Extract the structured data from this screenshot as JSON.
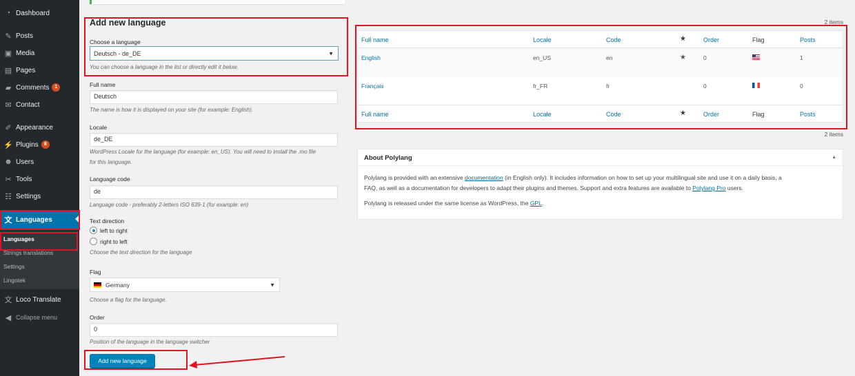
{
  "sidebar": {
    "items": [
      {
        "label": "Dashboard",
        "icon": "dashboard-icon"
      },
      {
        "label": "Posts",
        "icon": "pin-icon"
      },
      {
        "label": "Media",
        "icon": "media-icon"
      },
      {
        "label": "Pages",
        "icon": "pages-icon"
      },
      {
        "label": "Comments",
        "icon": "comments-icon",
        "badge": "1"
      },
      {
        "label": "Contact",
        "icon": "mail-icon"
      },
      {
        "label": "Appearance",
        "icon": "brush-icon"
      },
      {
        "label": "Plugins",
        "icon": "plug-icon",
        "badge": "8"
      },
      {
        "label": "Users",
        "icon": "user-icon"
      },
      {
        "label": "Tools",
        "icon": "wrench-icon"
      },
      {
        "label": "Settings",
        "icon": "sliders-icon"
      },
      {
        "label": "Languages",
        "icon": "translate-icon"
      },
      {
        "label": "Loco Translate",
        "icon": "translate-icon"
      },
      {
        "label": "Collapse menu",
        "icon": "collapse-icon"
      }
    ],
    "submenu": [
      "Languages",
      "Strings translations",
      "Settings",
      "Lingotek"
    ]
  },
  "form": {
    "title": "Add new language",
    "choose_label": "Choose a language",
    "choose_value": "Deutsch - de_DE",
    "choose_desc": "You can choose a language in the list or directly edit it below.",
    "fullname_label": "Full name",
    "fullname_value": "Deutsch",
    "fullname_desc": "The name is how it is displayed on your site (for example: English).",
    "locale_label": "Locale",
    "locale_value": "de_DE",
    "locale_desc_1": "WordPress Locale for the language (for example: en_US). You will need to install the .mo file",
    "locale_desc_2": "for this language.",
    "code_label": "Language code",
    "code_value": "de",
    "code_desc": "Language code - preferably 2-letters ISO 639-1 (for example: en)",
    "dir_label": "Text direction",
    "dir_ltr": "left to right",
    "dir_rtl": "right to left",
    "dir_selected": "ltr",
    "dir_desc": "Choose the text direction for the language",
    "flag_label": "Flag",
    "flag_value": "Germany",
    "flag_desc": "Choose a flag for the language.",
    "order_label": "Order",
    "order_value": "0",
    "order_desc": "Position of the language in the language switcher",
    "submit": "Add new language"
  },
  "table": {
    "count_text": "2 items",
    "columns": {
      "name": "Full name",
      "locale": "Locale",
      "code": "Code",
      "default_icon": "star-icon",
      "order": "Order",
      "flag": "Flag",
      "posts": "Posts"
    },
    "rows": [
      {
        "name": "English",
        "locale": "en_US",
        "code": "en",
        "default": true,
        "order": "0",
        "flag": "flag-us",
        "posts": "1"
      },
      {
        "name": "Français",
        "locale": "fr_FR",
        "code": "fr",
        "default": false,
        "order": "0",
        "flag": "flag-fr",
        "posts": "0"
      }
    ]
  },
  "about": {
    "title": "About Polylang",
    "p1_a": "Polylang is provided with an extensive ",
    "p1_link1": "documentation",
    "p1_b": " (in English only). It includes information on how to set up your multilingual site and use it on a daily basis, a",
    "p1_c": "FAQ, as well as a documentation for developers to adapt their plugins and themes. Support and extra features are available to ",
    "p1_link2": "Polylang Pro",
    "p1_d": " users.",
    "p2_a": "Polylang is released under the same license as WordPress, the ",
    "p2_link": "GPL",
    "p2_b": "."
  }
}
